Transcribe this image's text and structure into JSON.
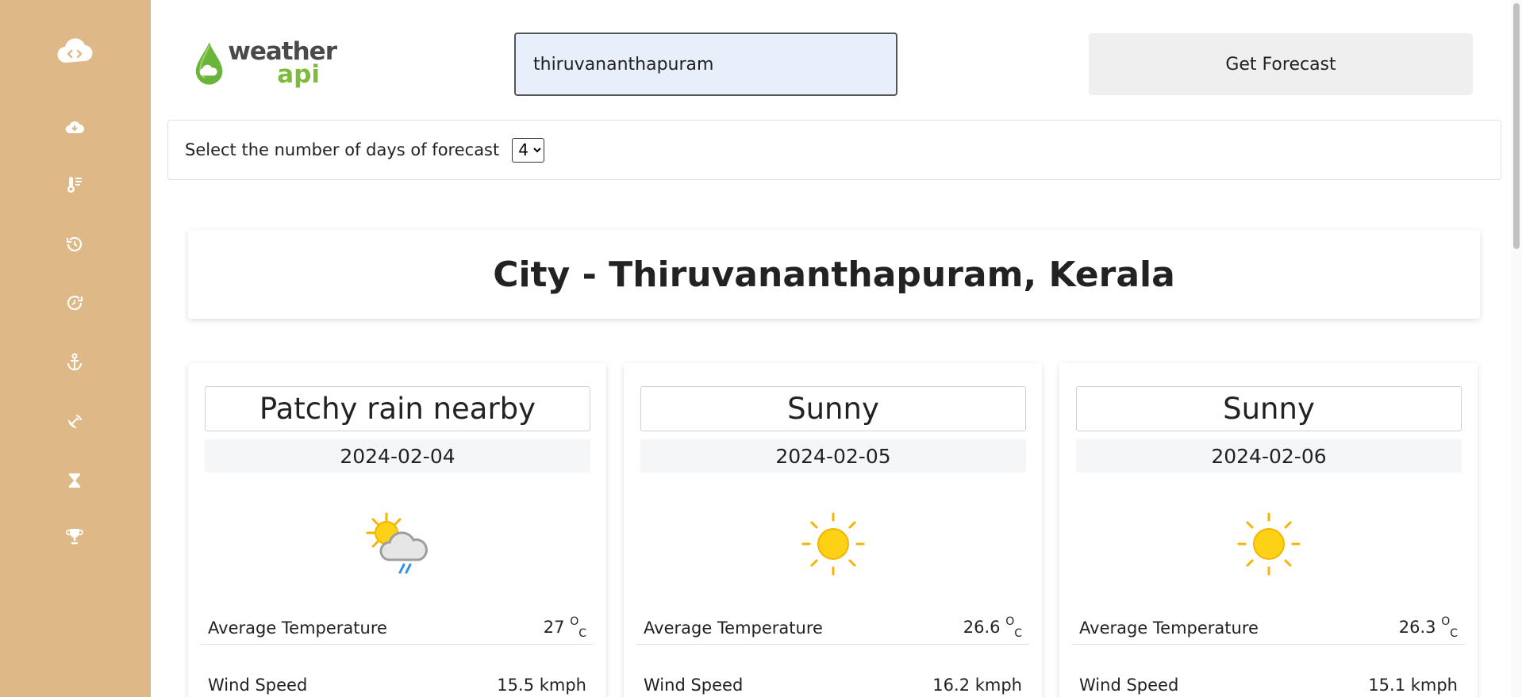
{
  "sidebar": {
    "logo_icon": "cloud-code-icon",
    "items": [
      {
        "icon": "cloud-download-icon"
      },
      {
        "icon": "thermometer-list-icon"
      },
      {
        "icon": "history-icon"
      },
      {
        "icon": "clock-forward-icon"
      },
      {
        "icon": "anchor-icon"
      },
      {
        "icon": "satellite-dish-icon"
      },
      {
        "icon": "hourglass-icon"
      },
      {
        "icon": "trophy-icon"
      }
    ],
    "bg_color": "#deb887"
  },
  "brand": {
    "line1": "weather",
    "line2": "api"
  },
  "search": {
    "value": "thiruvananthapuram",
    "button_label": "Get Forecast"
  },
  "days": {
    "label": "Select the number of days of forecast",
    "selected": "4"
  },
  "city": {
    "title": "City - Thiruvananthapuram, Kerala"
  },
  "units": {
    "deg": "O",
    "c": "C"
  },
  "forecast": [
    {
      "condition": "Patchy rain nearby",
      "date": "2024-02-04",
      "icon": "patchy-rain-icon",
      "avg_temp_label": "Average Temperature",
      "avg_temp": "27",
      "wind_label": "Wind Speed",
      "wind": "15.5 kmph"
    },
    {
      "condition": "Sunny",
      "date": "2024-02-05",
      "icon": "sun-icon",
      "avg_temp_label": "Average Temperature",
      "avg_temp": "26.6",
      "wind_label": "Wind Speed",
      "wind": "16.2 kmph"
    },
    {
      "condition": "Sunny",
      "date": "2024-02-06",
      "icon": "sun-icon",
      "avg_temp_label": "Average Temperature",
      "avg_temp": "26.3",
      "wind_label": "Wind Speed",
      "wind": "15.1 kmph"
    }
  ]
}
